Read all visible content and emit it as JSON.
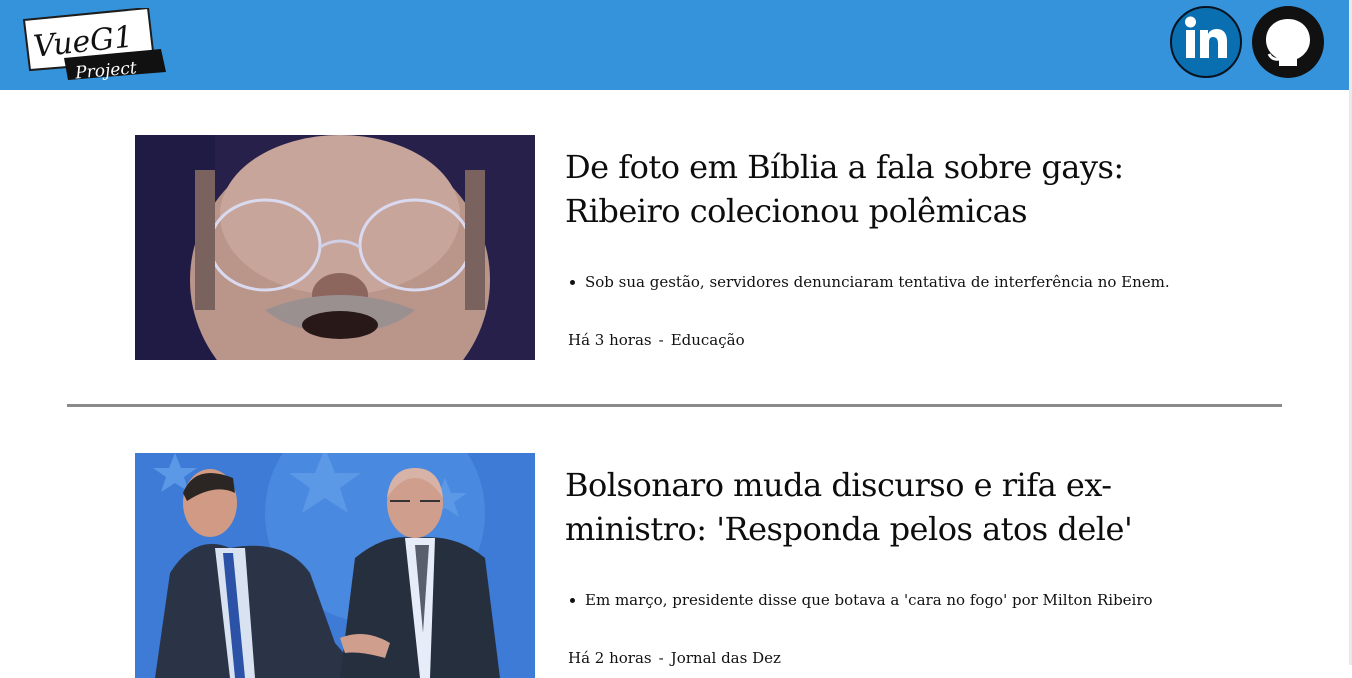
{
  "header": {
    "logo_line1": "VueG1",
    "logo_line2": "Project",
    "brand_color": "#3593dc",
    "social": [
      {
        "name": "linkedin-icon",
        "label": "in"
      },
      {
        "name": "github-icon",
        "label": ""
      }
    ]
  },
  "articles": [
    {
      "title": "De foto em Bíblia a fala sobre gays: Ribeiro colecionou polêmicas",
      "summary": "Sob sua gestão, servidores denunciaram tentativa de interferência no Enem.",
      "time": "Há 3 horas",
      "separator": "-",
      "section": "Educação"
    },
    {
      "title": "Bolsonaro muda discurso e rifa ex-ministro: 'Responda pelos atos dele'",
      "summary": "Em março, presidente disse que botava a 'cara no fogo' por Milton Ribeiro",
      "time": "Há 2 horas",
      "separator": "-",
      "section": "Jornal das Dez"
    }
  ]
}
